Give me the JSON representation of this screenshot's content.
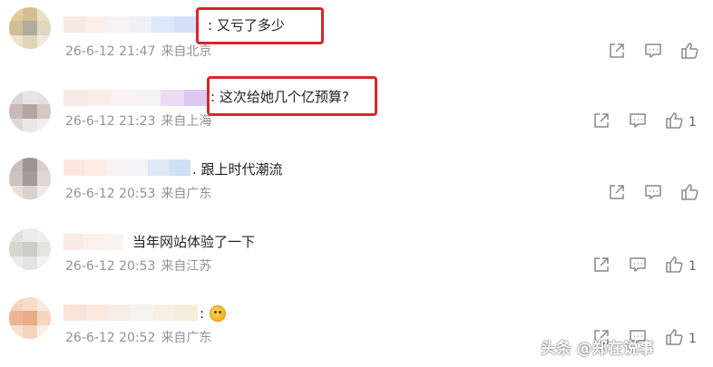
{
  "comments": [
    {
      "text": ": 又亏了多少",
      "time": "26-6-12 21:47",
      "location": "来自北京",
      "likes": "",
      "highlighted": true
    },
    {
      "text": ": 这次给她几个亿预算?",
      "time": "26-6-12 21:23",
      "location": "来自上海",
      "likes": "1",
      "highlighted": true
    },
    {
      "text": ". 跟上时代潮流",
      "time": "26-6-12 20:53",
      "location": "来自广东",
      "likes": "",
      "highlighted": false
    },
    {
      "text": "当年网站体验了一下",
      "time": "26-6-12 20:53",
      "location": "来自江苏",
      "likes": "1",
      "highlighted": false
    },
    {
      "text": ":",
      "time": "26-6-12 20:52",
      "location": "来自广东",
      "likes": "1",
      "highlighted": false,
      "emoji": "laughing-emoji-icon"
    }
  ],
  "icons": {
    "share": "share-icon",
    "comment": "comment-icon",
    "like": "like-icon"
  },
  "colors": {
    "highlight_border": "#d9262b",
    "meta_text": "#939393",
    "body_text": "#222222"
  },
  "watermark": {
    "text": "头条 @郑在说事"
  }
}
